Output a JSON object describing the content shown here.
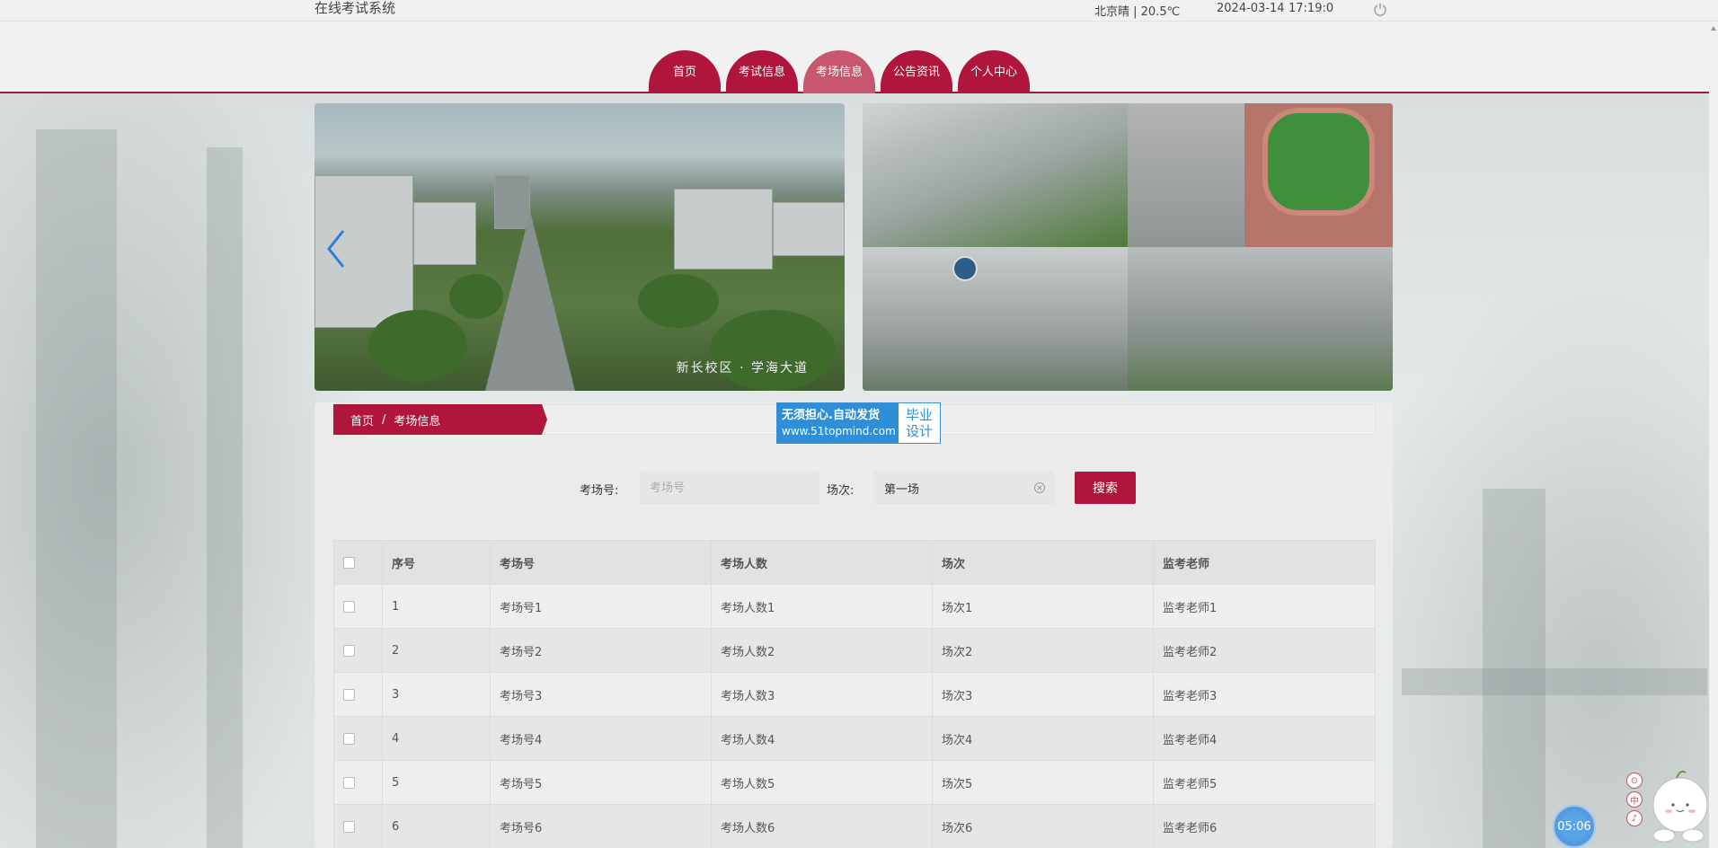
{
  "topbar": {
    "site_title": "在线考试系统",
    "weather": "北京晴 | 20.5℃",
    "date": "2024-03-14",
    "time": "17:19:0"
  },
  "nav": {
    "items": [
      "首页",
      "考试信息",
      "考场信息",
      "公告资讯",
      "个人中心"
    ],
    "active_index": 2
  },
  "banner": {
    "left_caption": "新长校区 · 学海大道"
  },
  "breadcrumb": {
    "home": "首页",
    "sep": "/",
    "current": "考场信息"
  },
  "ad": {
    "line1": "无须担心.自动发货",
    "line2": "www.51topmind.com",
    "right_top": "毕业",
    "right_bottom": "设计"
  },
  "search": {
    "room_label": "考场号:",
    "room_placeholder": "考场号",
    "room_value": "",
    "session_label": "场次:",
    "session_value": "第一场",
    "button": "搜索"
  },
  "table": {
    "headers": [
      "序号",
      "考场号",
      "考场人数",
      "场次",
      "监考老师"
    ],
    "rows": [
      [
        "1",
        "考场号1",
        "考场人数1",
        "场次1",
        "监考老师1"
      ],
      [
        "2",
        "考场号2",
        "考场人数2",
        "场次2",
        "监考老师2"
      ],
      [
        "3",
        "考场号3",
        "考场人数3",
        "场次3",
        "监考老师3"
      ],
      [
        "4",
        "考场号4",
        "考场人数4",
        "场次4",
        "监考老师4"
      ],
      [
        "5",
        "考场号5",
        "考场人数5",
        "场次5",
        "监考老师5"
      ],
      [
        "6",
        "考场号6",
        "考场人数6",
        "场次6",
        "监考老师6"
      ]
    ]
  },
  "widgets": {
    "timer": "05:06",
    "side_icons": [
      "⊙",
      "中",
      "♪"
    ]
  },
  "colors": {
    "brand": "#b0163b",
    "active_tab": "#c9566f",
    "ad_blue": "#2f8ed8"
  }
}
